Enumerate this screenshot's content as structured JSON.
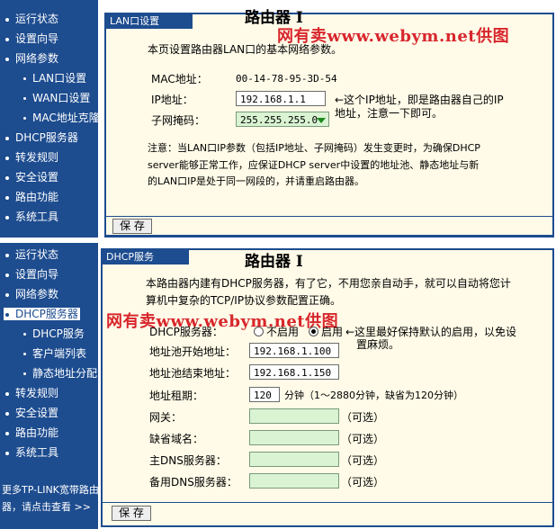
{
  "top": {
    "sidebar": [
      "运行状态",
      "设置向导",
      "网络参数",
      "LAN口设置",
      "WAN口设置",
      "MAC地址克隆",
      "DHCP服务器",
      "转发规则",
      "安全设置",
      "路由功能",
      "系统工具"
    ],
    "panel_header": "LAN口设置",
    "big_title": "路由器 I",
    "watermark": "网有卖www.webym.net供图",
    "intro": "本页设置路由器LAN口的基本网络参数。",
    "mac_label": "MAC地址：",
    "mac_value": "00-14-78-95-3D-54",
    "ip_label": "IP地址：",
    "ip_value": "192.168.1.1",
    "mask_label": "子网掩码：",
    "mask_value": "255.255.255.0",
    "ip_note_line1": "←这个IP地址，即是路由器自己的IP",
    "ip_note_line2": "地址，注意一下即可。",
    "notice_line1": "注意：当LAN口IP参数（包括IP地址、子网掩码）发生变更时，为确保DHCP",
    "notice_line2": "server能够正常工作，应保证DHCP server中设置的地址池、静态地址与新",
    "notice_line3": "的LAN口IP是处于同一网段的，并请重启路由器。",
    "save_label": "保 存"
  },
  "bottom": {
    "sidebar": [
      "运行状态",
      "设置向导",
      "网络参数",
      "DHCP服务器",
      "DHCP服务",
      "客户端列表",
      "静态地址分配",
      "转发规则",
      "安全设置",
      "路由功能",
      "系统工具"
    ],
    "sidebar_more_line1": "更多TP-LINK宽带路由",
    "sidebar_more_line2": "器，请点击查看 >>",
    "panel_header": "DHCP服务",
    "big_title": "路由器 I",
    "watermark": "网有卖www.webym.net供图",
    "intro_line1": "本路由器内建有DHCP服务器，有了它，不用您亲自动手，就可以自动将您计",
    "intro_line2": "算机中复杂的TCP/IP协议参数配置正确。",
    "dhcp_label": "DHCP服务器：",
    "radio_off": "不启用",
    "radio_on": "启用",
    "dhcp_note_line1": "←这里最好保持默认的启用，以免设",
    "dhcp_note_line2": "置麻烦。",
    "start_label": "地址池开始地址：",
    "start_value": "192.168.1.100",
    "end_label": "地址池结束地址：",
    "end_value": "192.168.1.150",
    "lease_label": "地址租期：",
    "lease_value": "120",
    "lease_unit": "分钟（1～2880分钟，缺省为120分钟）",
    "gateway_label": "网关：",
    "domain_label": "缺省域名：",
    "dns1_label": "主DNS服务器：",
    "dns2_label": "备用DNS服务器：",
    "optional": "（可选）",
    "save_label": "保 存"
  },
  "colors": {
    "nav_bg": "#1d4c8f",
    "panel_bg": "#fffbe8",
    "watermark": "#d8262c",
    "input_green": "#d9f3d3"
  }
}
